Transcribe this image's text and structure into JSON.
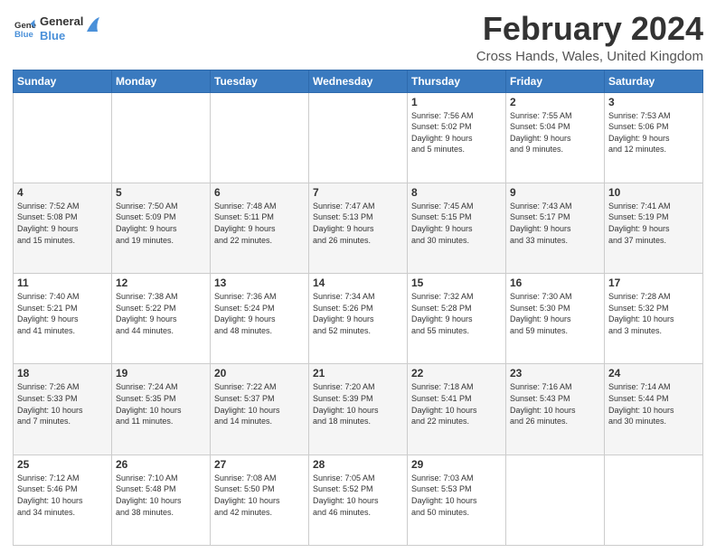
{
  "logo": {
    "line1": "General",
    "line2": "Blue"
  },
  "title": "February 2024",
  "subtitle": "Cross Hands, Wales, United Kingdom",
  "weekdays": [
    "Sunday",
    "Monday",
    "Tuesday",
    "Wednesday",
    "Thursday",
    "Friday",
    "Saturday"
  ],
  "weeks": [
    [
      {
        "day": "",
        "info": ""
      },
      {
        "day": "",
        "info": ""
      },
      {
        "day": "",
        "info": ""
      },
      {
        "day": "",
        "info": ""
      },
      {
        "day": "1",
        "info": "Sunrise: 7:56 AM\nSunset: 5:02 PM\nDaylight: 9 hours\nand 5 minutes."
      },
      {
        "day": "2",
        "info": "Sunrise: 7:55 AM\nSunset: 5:04 PM\nDaylight: 9 hours\nand 9 minutes."
      },
      {
        "day": "3",
        "info": "Sunrise: 7:53 AM\nSunset: 5:06 PM\nDaylight: 9 hours\nand 12 minutes."
      }
    ],
    [
      {
        "day": "4",
        "info": "Sunrise: 7:52 AM\nSunset: 5:08 PM\nDaylight: 9 hours\nand 15 minutes."
      },
      {
        "day": "5",
        "info": "Sunrise: 7:50 AM\nSunset: 5:09 PM\nDaylight: 9 hours\nand 19 minutes."
      },
      {
        "day": "6",
        "info": "Sunrise: 7:48 AM\nSunset: 5:11 PM\nDaylight: 9 hours\nand 22 minutes."
      },
      {
        "day": "7",
        "info": "Sunrise: 7:47 AM\nSunset: 5:13 PM\nDaylight: 9 hours\nand 26 minutes."
      },
      {
        "day": "8",
        "info": "Sunrise: 7:45 AM\nSunset: 5:15 PM\nDaylight: 9 hours\nand 30 minutes."
      },
      {
        "day": "9",
        "info": "Sunrise: 7:43 AM\nSunset: 5:17 PM\nDaylight: 9 hours\nand 33 minutes."
      },
      {
        "day": "10",
        "info": "Sunrise: 7:41 AM\nSunset: 5:19 PM\nDaylight: 9 hours\nand 37 minutes."
      }
    ],
    [
      {
        "day": "11",
        "info": "Sunrise: 7:40 AM\nSunset: 5:21 PM\nDaylight: 9 hours\nand 41 minutes."
      },
      {
        "day": "12",
        "info": "Sunrise: 7:38 AM\nSunset: 5:22 PM\nDaylight: 9 hours\nand 44 minutes."
      },
      {
        "day": "13",
        "info": "Sunrise: 7:36 AM\nSunset: 5:24 PM\nDaylight: 9 hours\nand 48 minutes."
      },
      {
        "day": "14",
        "info": "Sunrise: 7:34 AM\nSunset: 5:26 PM\nDaylight: 9 hours\nand 52 minutes."
      },
      {
        "day": "15",
        "info": "Sunrise: 7:32 AM\nSunset: 5:28 PM\nDaylight: 9 hours\nand 55 minutes."
      },
      {
        "day": "16",
        "info": "Sunrise: 7:30 AM\nSunset: 5:30 PM\nDaylight: 9 hours\nand 59 minutes."
      },
      {
        "day": "17",
        "info": "Sunrise: 7:28 AM\nSunset: 5:32 PM\nDaylight: 10 hours\nand 3 minutes."
      }
    ],
    [
      {
        "day": "18",
        "info": "Sunrise: 7:26 AM\nSunset: 5:33 PM\nDaylight: 10 hours\nand 7 minutes."
      },
      {
        "day": "19",
        "info": "Sunrise: 7:24 AM\nSunset: 5:35 PM\nDaylight: 10 hours\nand 11 minutes."
      },
      {
        "day": "20",
        "info": "Sunrise: 7:22 AM\nSunset: 5:37 PM\nDaylight: 10 hours\nand 14 minutes."
      },
      {
        "day": "21",
        "info": "Sunrise: 7:20 AM\nSunset: 5:39 PM\nDaylight: 10 hours\nand 18 minutes."
      },
      {
        "day": "22",
        "info": "Sunrise: 7:18 AM\nSunset: 5:41 PM\nDaylight: 10 hours\nand 22 minutes."
      },
      {
        "day": "23",
        "info": "Sunrise: 7:16 AM\nSunset: 5:43 PM\nDaylight: 10 hours\nand 26 minutes."
      },
      {
        "day": "24",
        "info": "Sunrise: 7:14 AM\nSunset: 5:44 PM\nDaylight: 10 hours\nand 30 minutes."
      }
    ],
    [
      {
        "day": "25",
        "info": "Sunrise: 7:12 AM\nSunset: 5:46 PM\nDaylight: 10 hours\nand 34 minutes."
      },
      {
        "day": "26",
        "info": "Sunrise: 7:10 AM\nSunset: 5:48 PM\nDaylight: 10 hours\nand 38 minutes."
      },
      {
        "day": "27",
        "info": "Sunrise: 7:08 AM\nSunset: 5:50 PM\nDaylight: 10 hours\nand 42 minutes."
      },
      {
        "day": "28",
        "info": "Sunrise: 7:05 AM\nSunset: 5:52 PM\nDaylight: 10 hours\nand 46 minutes."
      },
      {
        "day": "29",
        "info": "Sunrise: 7:03 AM\nSunset: 5:53 PM\nDaylight: 10 hours\nand 50 minutes."
      },
      {
        "day": "",
        "info": ""
      },
      {
        "day": "",
        "info": ""
      }
    ]
  ]
}
